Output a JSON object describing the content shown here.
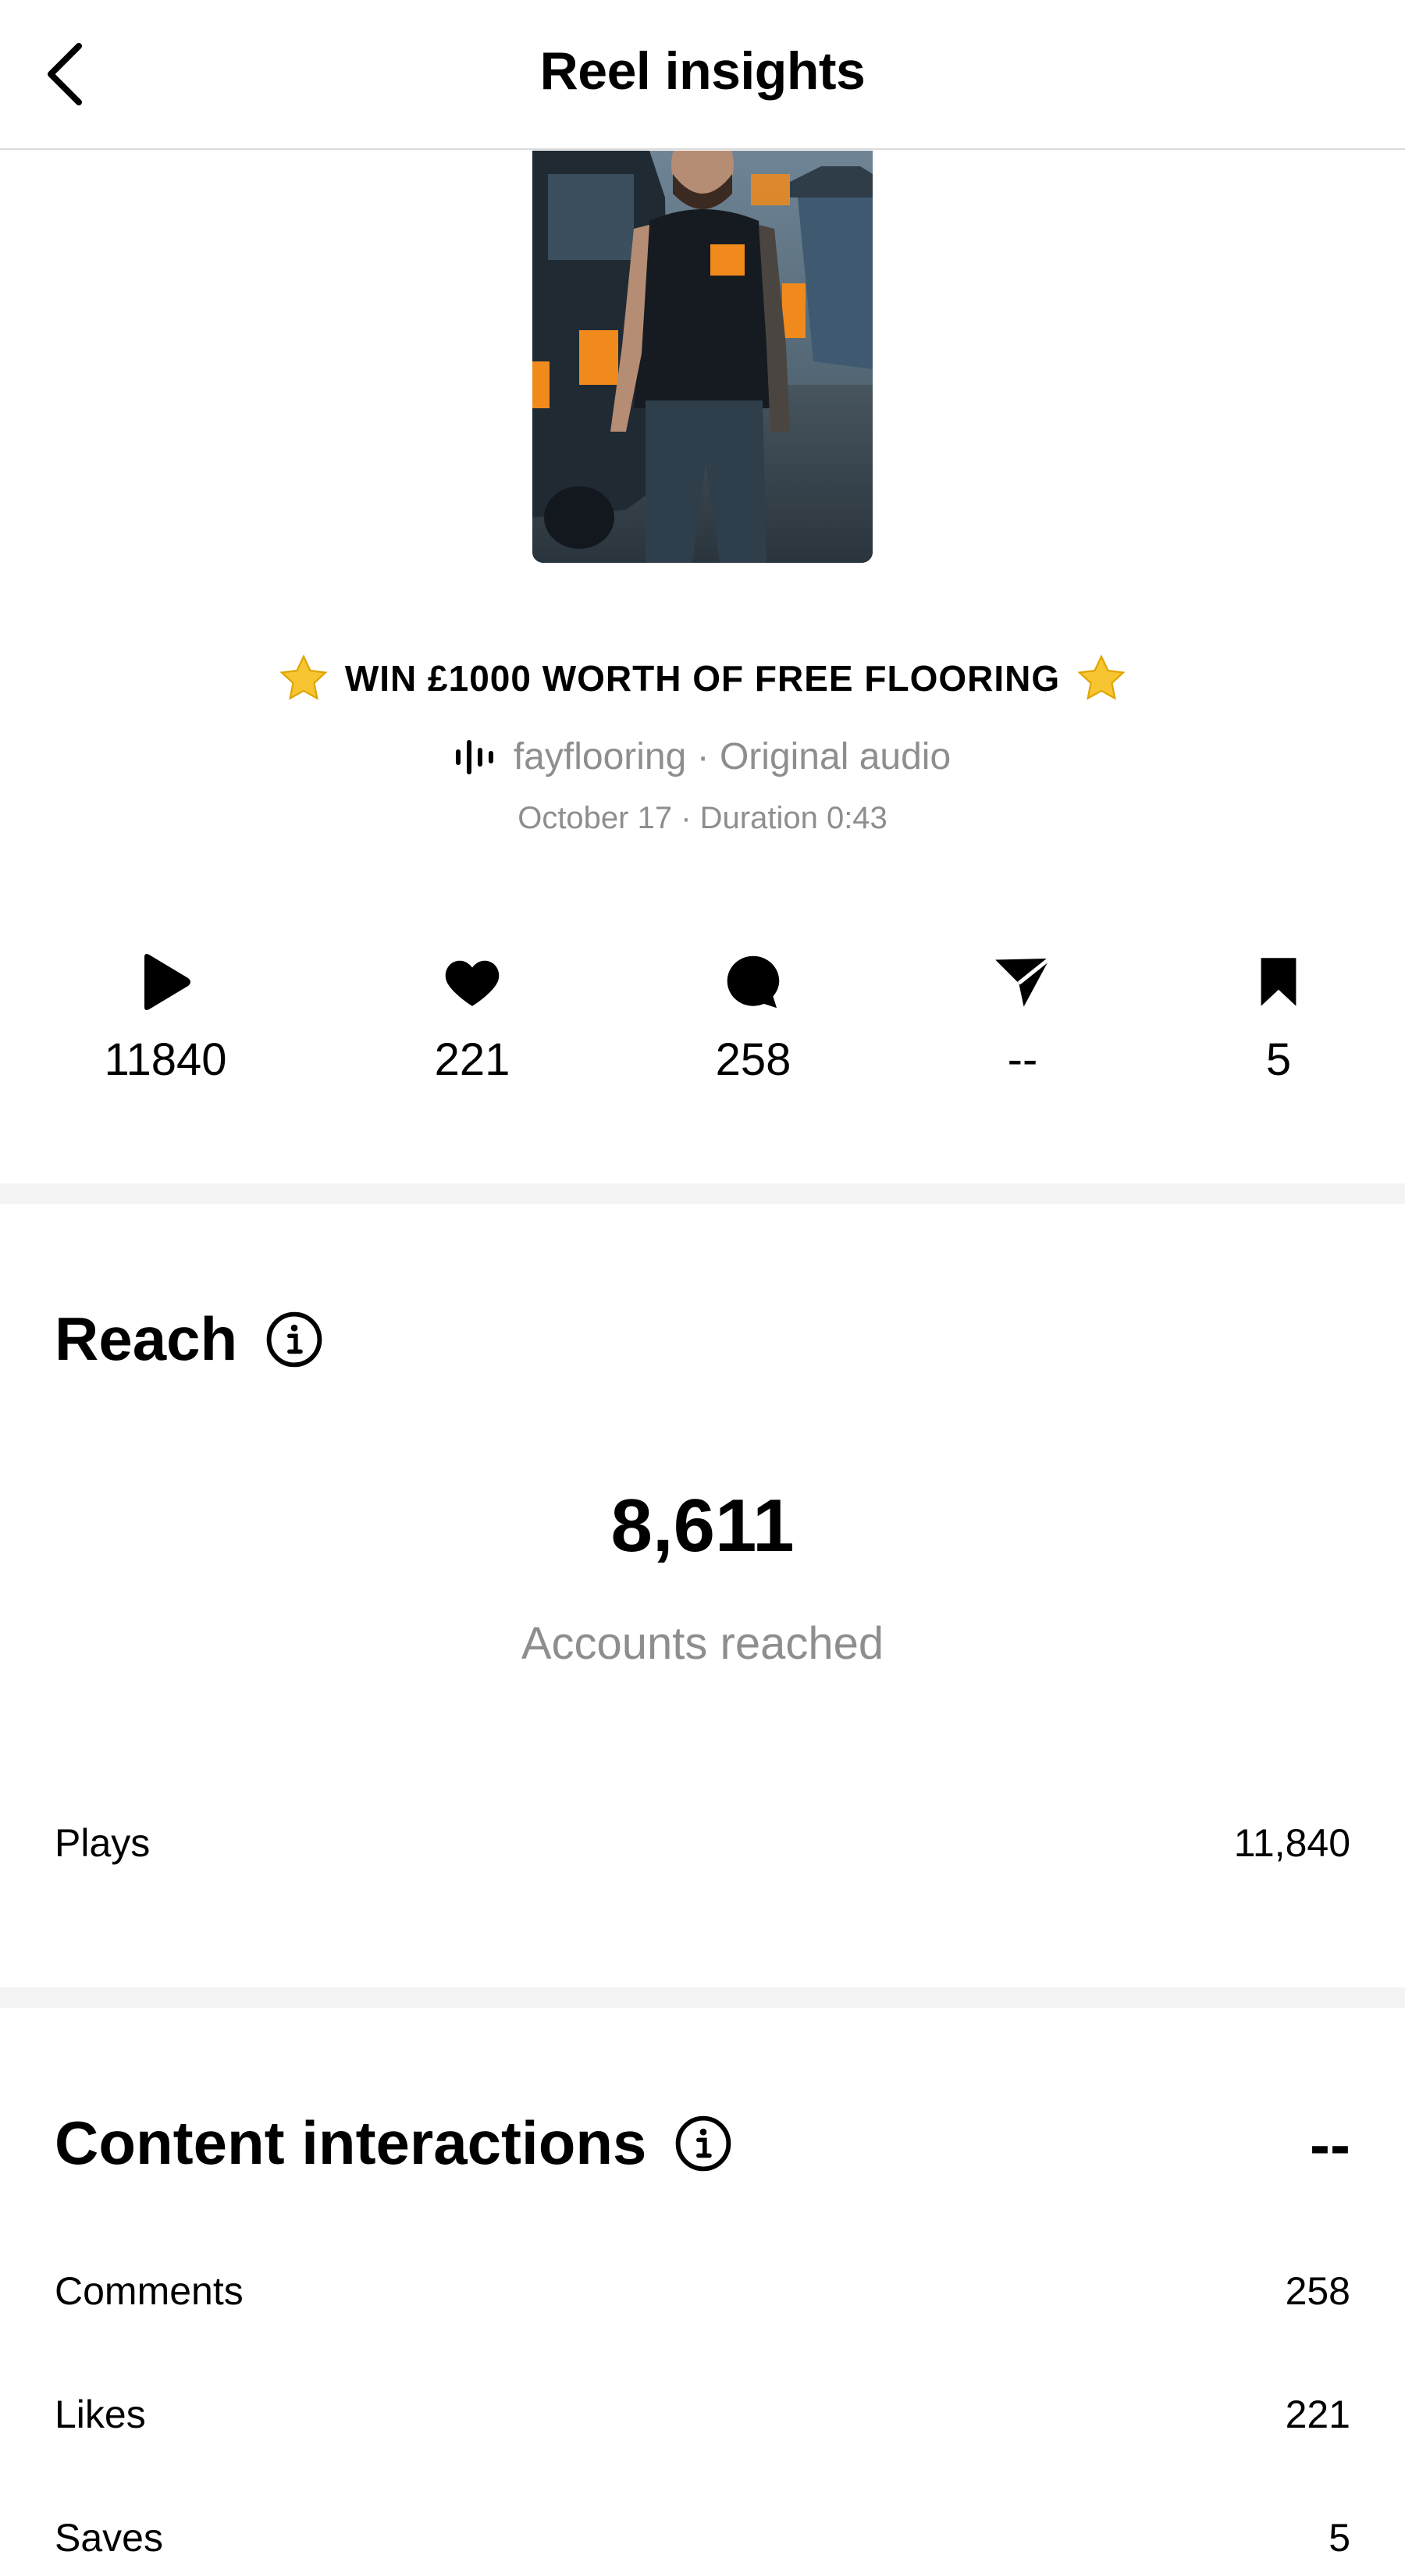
{
  "header": {
    "title": "Reel insights"
  },
  "reel": {
    "caption": "WIN £1000 WORTH OF FREE FLOORING",
    "audio": "fayflooring · Original audio",
    "meta": "October 17 · Duration 0:43"
  },
  "stats": {
    "plays": "11840",
    "likes": "221",
    "comments": "258",
    "shares": "--",
    "saves": "5"
  },
  "reach": {
    "title": "Reach",
    "accounts_reached": "8,611",
    "accounts_reached_label": "Accounts reached",
    "rows": [
      {
        "label": "Plays",
        "value": "11,840"
      }
    ]
  },
  "content_interactions": {
    "title": "Content interactions",
    "value": "--",
    "rows": [
      {
        "label": "Comments",
        "value": "258"
      },
      {
        "label": "Likes",
        "value": "221"
      },
      {
        "label": "Saves",
        "value": "5"
      }
    ]
  },
  "colors": {
    "secondary_text": "#8e8e8e",
    "divider": "#dbdbdb",
    "section_band": "#f3f3f3",
    "star": "#f7c531",
    "accent_orange": "#f08a1c"
  }
}
